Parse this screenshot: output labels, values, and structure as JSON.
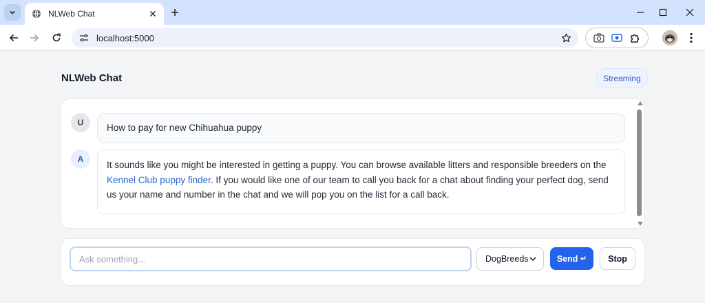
{
  "browser": {
    "tab_title": "NLWeb Chat",
    "url": "localhost:5000"
  },
  "app": {
    "title": "NLWeb Chat",
    "mode_badge": "Streaming"
  },
  "messages": [
    {
      "role": "user",
      "avatar": "U",
      "text": "How to pay for new Chihuahua puppy"
    },
    {
      "role": "assistant",
      "avatar": "A",
      "text_before_link": "It sounds like you might be interested in getting a puppy. You can browse available litters and responsible breeders on the ",
      "link_text": "Kennel Club puppy finder",
      "text_after_link": ". If you would like one of our team to call you back for a chat about finding your perfect dog, send us your name and number in the chat and we will pop you on the list for a call back."
    }
  ],
  "composer": {
    "placeholder": "Ask something...",
    "value": "",
    "site_selected": "DogBreeds",
    "send_label": "Send",
    "send_glyph": "↵",
    "stop_label": "Stop"
  },
  "colors": {
    "accent": "#2463eb",
    "tabbar": "#d3e3fd",
    "link": "#2a63d4"
  }
}
